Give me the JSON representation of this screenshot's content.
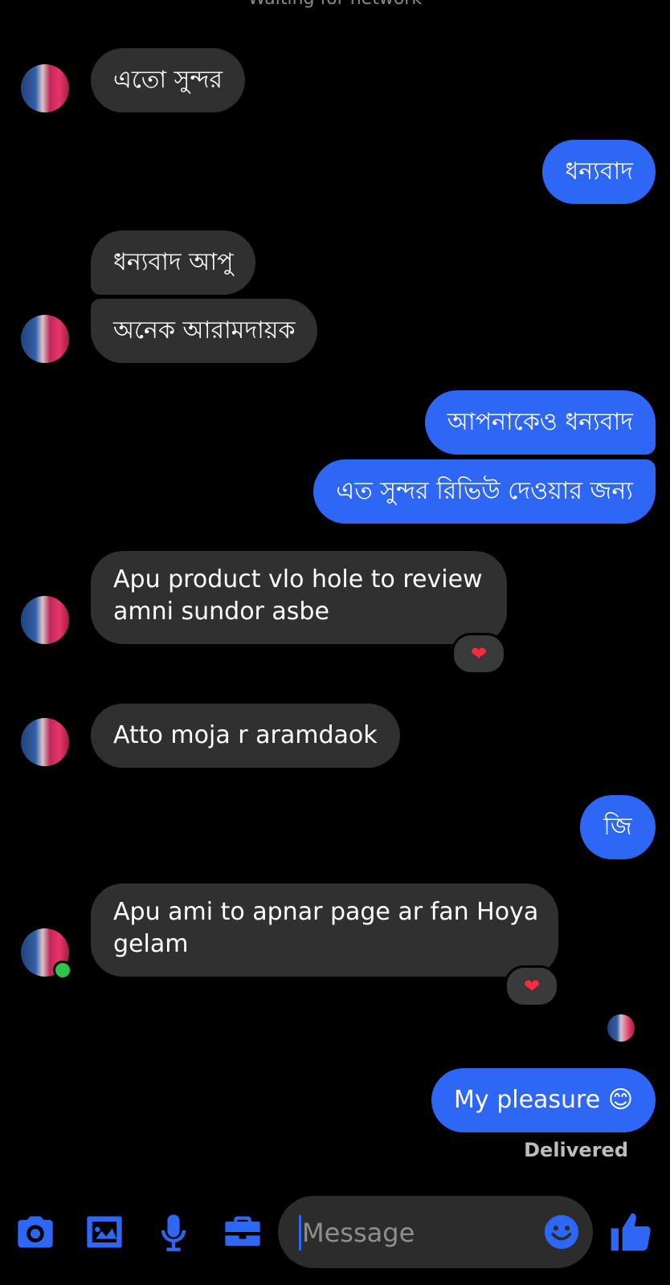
{
  "header": {
    "status_text": "Waiting for network"
  },
  "messages": [
    {
      "side": "received",
      "text": "এতো সুন্দর"
    },
    {
      "side": "sent",
      "text": "ধন্যবাদ"
    },
    {
      "side": "received",
      "text": "ধন্যবাদ আপু"
    },
    {
      "side": "received",
      "text": "অনেক আরামদায়ক"
    },
    {
      "side": "sent",
      "text": "আপনাকেও ধন্যবাদ"
    },
    {
      "side": "sent",
      "text": "এত সুন্দর রিভিউ দেওয়ার জন্য"
    },
    {
      "side": "received",
      "line1": "Apu product vlo hole to review",
      "line2": "amni sundor asbe",
      "reaction": "❤"
    },
    {
      "side": "received",
      "text": "Atto moja r aramdaok"
    },
    {
      "side": "sent",
      "text": "জি"
    },
    {
      "side": "received",
      "line1": "Apu ami to apnar page ar fan Hoya",
      "line2": "gelam",
      "reaction": "❤"
    },
    {
      "side": "sent",
      "text": "My pleasure 😊"
    }
  ],
  "status": {
    "delivered": "Delivered"
  },
  "composer": {
    "placeholder": "Message",
    "icons": [
      "camera-icon",
      "image-icon",
      "microphone-icon",
      "briefcase-icon",
      "emoji-icon",
      "thumbs-up-icon"
    ]
  },
  "colors": {
    "sent_bubble": "#2e67f5",
    "received_bubble": "#303030",
    "background": "#000000",
    "accent": "#2e67f5"
  }
}
